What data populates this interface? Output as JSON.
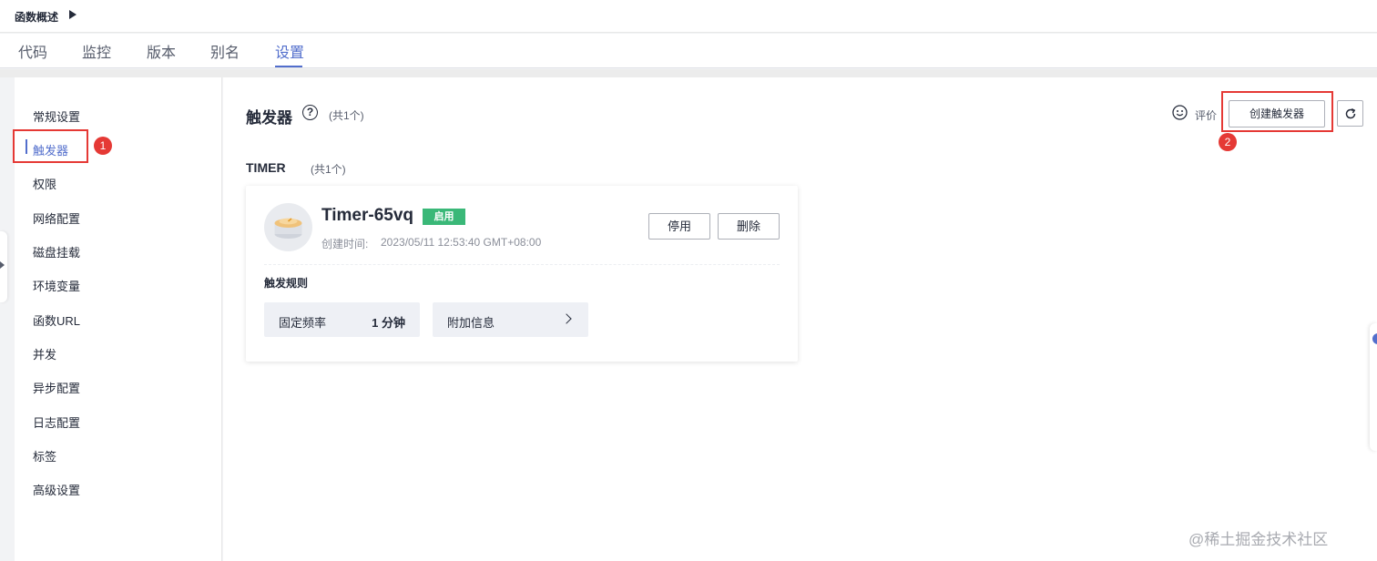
{
  "breadcrumb": {
    "label": "函数概述"
  },
  "tabs": [
    {
      "label": "代码"
    },
    {
      "label": "监控"
    },
    {
      "label": "版本"
    },
    {
      "label": "别名"
    },
    {
      "label": "设置",
      "active": true
    }
  ],
  "sidebar": {
    "items": [
      {
        "label": "常规设置"
      },
      {
        "label": "触发器",
        "active": true
      },
      {
        "label": "权限"
      },
      {
        "label": "网络配置"
      },
      {
        "label": "磁盘挂载"
      },
      {
        "label": "环境变量"
      },
      {
        "label": "函数URL"
      },
      {
        "label": "并发"
      },
      {
        "label": "异步配置"
      },
      {
        "label": "日志配置"
      },
      {
        "label": "标签"
      },
      {
        "label": "高级设置"
      }
    ]
  },
  "annotations": {
    "step1": "1",
    "step2": "2"
  },
  "header": {
    "title": "触发器",
    "count": "(共1个)",
    "rate_label": "评价",
    "create_button": "创建触发器",
    "help_icon": "question-circle-icon",
    "refresh_icon": "refresh-icon"
  },
  "section": {
    "label": "TIMER",
    "count": "(共1个)"
  },
  "trigger": {
    "name": "Timer-65vq",
    "status": "启用",
    "created_label": "创建时间:",
    "created_value": "2023/05/11 12:53:40 GMT+08:00",
    "disable_button": "停用",
    "delete_button": "删除",
    "rule_label": "触发规则",
    "rule_key": "固定频率",
    "rule_value": "1 分钟",
    "extra_label": "附加信息"
  },
  "watermark": "@稀土掘金技术社区",
  "colors": {
    "accent": "#526ecc",
    "enabled": "#3ab878",
    "annotation": "#e53935"
  }
}
